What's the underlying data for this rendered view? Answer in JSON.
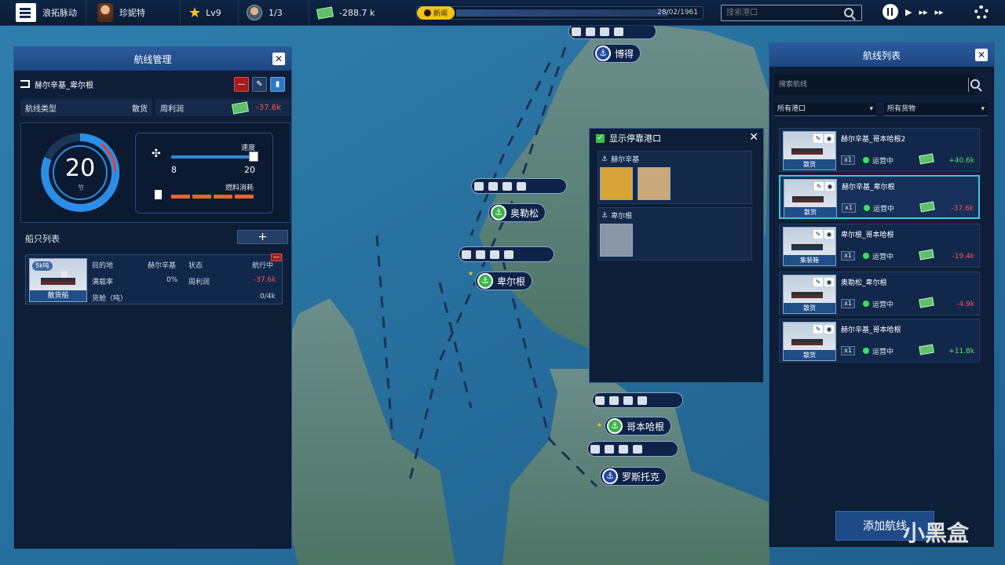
{
  "topbar": {
    "company": "浪拓脉动",
    "player": "珍妮特",
    "level": "Lv9",
    "crew": "1/3",
    "cash": "-288.7 k",
    "news_label": "新闻",
    "date": "28/02/1961",
    "search_placeholder": "搜索港口"
  },
  "left_panel": {
    "title": "航线管理",
    "route_name": "赫尔辛基_卑尔根",
    "route_type_label": "航线类型",
    "route_type": "散货",
    "weekly_profit_label": "周利润",
    "weekly_profit": "-37.6k",
    "speed_value": "20",
    "speed_unit": "节",
    "speed_label": "速度",
    "speed_min": "8",
    "speed_max": "20",
    "fuel_label": "燃料消耗",
    "ships_title": "船只列表",
    "add_label": "+",
    "ship": {
      "capacity": "5k吨",
      "type": "散货船",
      "dest_label": "目的地",
      "dest": "赫尔辛基",
      "status_label": "状态",
      "status": "航行中",
      "load_label": "满载率",
      "load": "0%",
      "profit_label": "周利润",
      "profit": "-37.6k",
      "hold_label": "货舱（吨）",
      "hold": "0/4k"
    }
  },
  "right_panel": {
    "title": "航线列表",
    "search_placeholder": "搜索航线",
    "filter_ports": "所有港口",
    "filter_goods": "所有货物",
    "add_route": "添加航线",
    "routes": [
      {
        "name": "赫尔辛基_哥本哈根2",
        "type": "散货",
        "count": "x1",
        "status": "运营中",
        "profit": "+40.6k"
      },
      {
        "name": "赫尔辛基_卑尔根",
        "type": "散货",
        "count": "x1",
        "status": "运营中",
        "profit": "-37.6k"
      },
      {
        "name": "卑尔根_哥本哈根",
        "type": "集装箱",
        "count": "x1",
        "status": "运营中",
        "profit": "-19.4k"
      },
      {
        "name": "奥勒松_卑尔根",
        "type": "散货",
        "count": "x1",
        "status": "运营中",
        "profit": "-4.9k"
      },
      {
        "name": "赫尔辛基_哥本哈根",
        "type": "散货",
        "count": "x1",
        "status": "运营中",
        "profit": "+11.8k"
      }
    ]
  },
  "port_popup": {
    "title": "显示停靠港口",
    "ports": [
      {
        "name": "赫尔辛基",
        "cargo": [
          "wheat-icon",
          "grain-bowl-icon"
        ]
      },
      {
        "name": "卑尔根",
        "cargo": [
          "ore-icon"
        ]
      }
    ]
  },
  "map_ports": {
    "bodo": "博得",
    "alesund": "奥勒松",
    "bergen": "卑尔根",
    "copenhagen": "哥本哈根",
    "rostock": "罗斯托克"
  },
  "watermark": "小黑盒",
  "colors": {
    "accent": "#2a5c98",
    "positive": "#5fe06a",
    "negative": "#ff5050",
    "selected": "#38c8e8"
  }
}
